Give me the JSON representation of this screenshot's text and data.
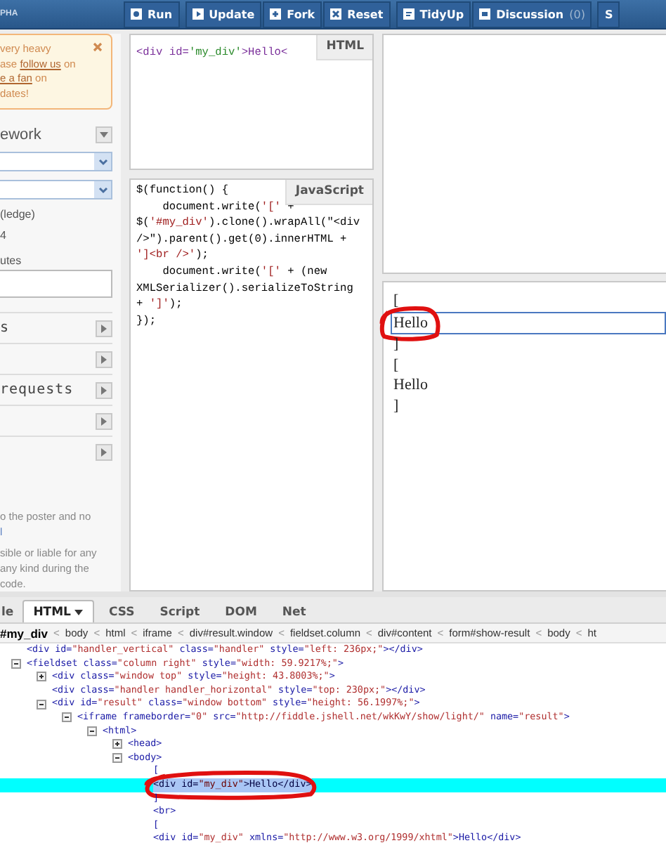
{
  "topbar": {
    "brand": "PHA",
    "button_groups": [
      [
        {
          "label": "Run"
        }
      ],
      [
        {
          "label": "Update"
        },
        {
          "label": "Fork"
        },
        {
          "label": "Reset"
        }
      ],
      [
        {
          "label": "TidyUp"
        },
        {
          "label": "Discussion",
          "count": "(0)"
        }
      ],
      [
        {
          "label": "S"
        }
      ]
    ]
  },
  "sidebar": {
    "notice": {
      "lines": [
        [
          {
            "text": "very heavy"
          }
        ],
        [
          {
            "text": "ase "
          },
          {
            "text": "follow us",
            "link": true
          },
          {
            "text": " on"
          }
        ],
        [
          {
            "text": "e a fan",
            "link": true
          },
          {
            "text": " on"
          }
        ],
        [
          {
            "text": "dates!"
          }
        ]
      ]
    },
    "framework": {
      "label": "ework",
      "expanded": false
    },
    "select_fields": [
      {
        "kind": "select"
      },
      {
        "kind": "select"
      }
    ],
    "options": [
      "(ledge)",
      "4"
    ],
    "resources_label": "utes",
    "panels": [
      {
        "label": "s",
        "expanded": false
      },
      {
        "expanded": false
      },
      {
        "label": "requests",
        "expanded": false
      },
      {
        "expanded": false
      },
      {
        "expanded": false
      }
    ],
    "legal": [
      [
        {
          "text": "o the poster and no"
        },
        {
          "text": "l",
          "link": true
        }
      ],
      [
        {
          "text": "sible or liable for any"
        },
        {
          "text": "any kind during the"
        },
        {
          "text": "code."
        }
      ]
    ]
  },
  "editors": [
    {
      "kind": "html",
      "tab": "HTML",
      "lines": [
        "<div id='my_div'>Hello<"
      ]
    },
    {
      "kind": "js",
      "tab": "JavaScript",
      "lines": [
        "$(function() {",
        "    document.write('[' +",
        "$('#my_div').clone().wrapAll(\"<div",
        "/>\").parent().get(0).innerHTML +",
        "']<br />');",
        "    document.write('[' + (new",
        "XMLSerializer().serializeToString",
        "+ ']');",
        "});"
      ]
    }
  ],
  "result": {
    "lines": [
      {
        "text": "[",
        "highlighted": false
      },
      {
        "text": "Hello",
        "highlighted": true
      },
      {
        "text": "]",
        "highlighted": false
      },
      {
        "text": "[",
        "highlighted": false
      },
      {
        "text": "Hello",
        "highlighted": false
      },
      {
        "text": "]",
        "highlighted": false
      }
    ]
  },
  "firebug": {
    "tabs": [
      {
        "label": "le",
        "selected": false
      },
      {
        "label": "HTML",
        "selected": true,
        "dropdown": true
      },
      {
        "label": "CSS",
        "selected": false
      },
      {
        "label": "Script",
        "selected": false
      },
      {
        "label": "DOM",
        "selected": false
      },
      {
        "label": "Net",
        "selected": false
      }
    ],
    "breadcrumb": [
      {
        "label": "#my_div",
        "selected": true,
        "separator": "<"
      },
      {
        "label": "body",
        "selected": false,
        "separator": "<"
      },
      {
        "label": "html",
        "selected": false,
        "separator": "<"
      },
      {
        "label": "iframe",
        "selected": false,
        "separator": "<"
      },
      {
        "label": "div#result.window",
        "selected": false,
        "separator": "<"
      },
      {
        "label": "fieldset.column",
        "selected": false,
        "separator": "<"
      },
      {
        "label": "div#content",
        "selected": false,
        "separator": "<"
      },
      {
        "label": "form#show-result",
        "selected": false,
        "separator": "<"
      },
      {
        "label": "body",
        "selected": false,
        "separator": "<"
      },
      {
        "label": "ht",
        "selected": false
      }
    ],
    "tree": [
      {
        "text": "<div id=\"handler_vertical\" class=\"handler\" style=\"left: 236px;\"></div>",
        "selected": false
      },
      {
        "text": "<fieldset class=\"column right\" style=\"width: 59.9217%;\">",
        "selected": false,
        "expanded": true,
        "children": [
          {
            "text": "<div class=\"window top\" style=\"height: 43.8003%;\">",
            "selected": false,
            "expanded": false
          },
          {
            "text": "<div class=\"handler handler_horizontal\" style=\"top: 230px;\"></div>",
            "selected": false
          },
          {
            "text": "<div id=\"result\" class=\"window bottom\" style=\"height: 56.1997%;\">",
            "selected": false,
            "expanded": true,
            "children": [
              {
                "text": "<iframe frameborder=\"0\" src=\"http://fiddle.jshell.net/wkKwY/show/light/\" name=\"result\">",
                "selected": false,
                "expanded": true,
                "children": [
                  {
                    "text": "<html>",
                    "selected": false,
                    "expanded": true,
                    "children": [
                      {
                        "text": "<head>",
                        "selected": false,
                        "expanded": false
                      },
                      {
                        "text": "<body>",
                        "selected": false,
                        "expanded": true,
                        "children": [
                          {
                            "text": "[",
                            "selected": false
                          },
                          {
                            "text": "<div id=\"my_div\">Hello</div>",
                            "selected": true
                          },
                          {
                            "text": "]",
                            "selected": false
                          },
                          {
                            "text": "<br>",
                            "selected": false
                          },
                          {
                            "text": "[",
                            "selected": false
                          },
                          {
                            "text": "<div id=\"my_div\" xmlns=\"http://www.w3.org/1999/xhtml\">Hello</div>",
                            "selected": false
                          }
                        ]
                      }
                    ]
                  }
                ]
              }
            ]
          }
        ]
      }
    ]
  }
}
